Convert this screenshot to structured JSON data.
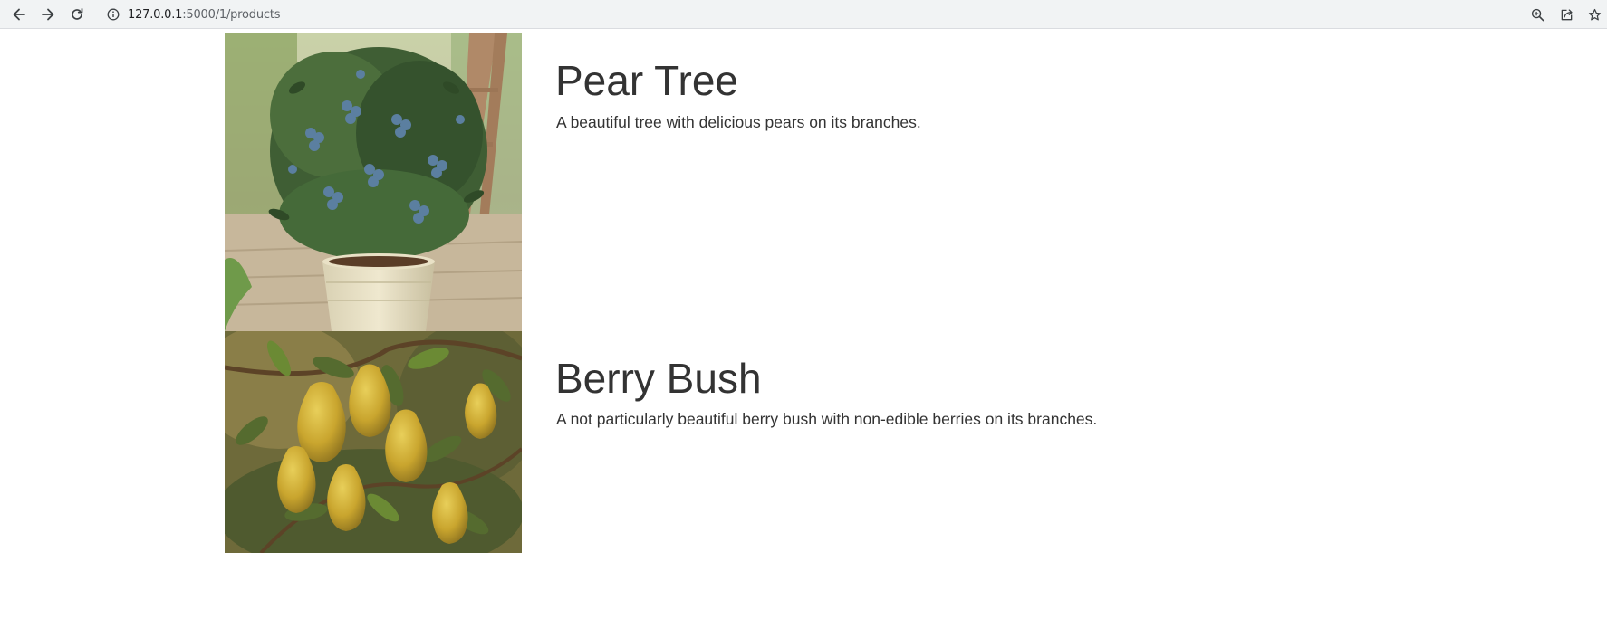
{
  "browser": {
    "url_host": "127.0.0.1",
    "url_path": ":5000/1/products",
    "icons": {
      "back": "arrow-back-icon",
      "forward": "arrow-forward-icon",
      "reload": "reload-icon",
      "info": "info-icon",
      "zoom": "zoom-icon",
      "share": "share-icon",
      "bookmark": "star-icon"
    }
  },
  "products": [
    {
      "title": "Pear Tree",
      "description": "A beautiful tree with delicious pears on its branches.",
      "image_subject": "blueberry bush in a cream pot"
    },
    {
      "title": "Berry Bush",
      "description": "A not particularly beautiful berry bush with non-edible berries on its branches.",
      "image_subject": "yellow pears on a tree branch"
    }
  ],
  "colors": {
    "text": "#333333",
    "toolbar": "#f1f3f4",
    "icon": "#5f6368"
  }
}
